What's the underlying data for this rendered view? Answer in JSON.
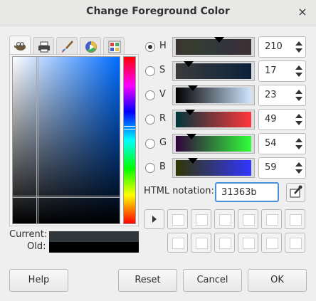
{
  "window": {
    "title": "Change Foreground Color",
    "close_glyph": "×"
  },
  "tabs": [
    {
      "name": "gimp-selector",
      "icon": "gimp-wilber-icon",
      "active": true
    },
    {
      "name": "cmyk-selector",
      "icon": "printer-icon",
      "active": false
    },
    {
      "name": "watercolor-selector",
      "icon": "brush-icon",
      "active": false
    },
    {
      "name": "wheel-selector",
      "icon": "color-wheel-icon",
      "active": false
    },
    {
      "name": "scales-selector",
      "icon": "palette-icon",
      "active": false
    }
  ],
  "current": {
    "label": "Current:",
    "color": "#31363b"
  },
  "old": {
    "label": "Old:",
    "color": "#000000"
  },
  "channels": [
    {
      "key": "H",
      "value": "210",
      "checked": true,
      "marker": 0.58
    },
    {
      "key": "S",
      "value": "17",
      "checked": false,
      "marker": 0.17
    },
    {
      "key": "V",
      "value": "23",
      "checked": false,
      "marker": 0.23
    },
    {
      "key": "R",
      "value": "49",
      "checked": false,
      "marker": 0.19
    },
    {
      "key": "G",
      "value": "54",
      "checked": false,
      "marker": 0.21
    },
    {
      "key": "B",
      "value": "59",
      "checked": false,
      "marker": 0.23
    }
  ],
  "html_notation": {
    "label": "HTML notation:",
    "value": "31363b"
  },
  "buttons": {
    "help": "Help",
    "reset": "Reset",
    "cancel": "Cancel",
    "ok": "OK"
  },
  "colors": {
    "accent": "#4a90d9"
  }
}
